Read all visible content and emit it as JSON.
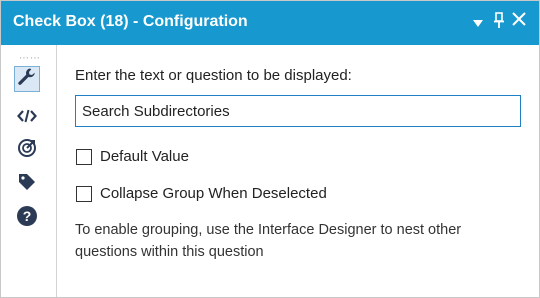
{
  "window": {
    "title": "Check Box (18) - Configuration",
    "controls": {
      "dropdown_icon": "triangle-down",
      "pin_icon": "pin",
      "close_icon": "close"
    }
  },
  "sidebar": {
    "items": [
      {
        "name": "configuration",
        "icon": "wrench",
        "active": true
      },
      {
        "name": "code",
        "icon": "code-brackets",
        "active": false
      },
      {
        "name": "connections",
        "icon": "target",
        "active": false
      },
      {
        "name": "annotation",
        "icon": "tag",
        "active": false
      },
      {
        "name": "help",
        "icon": "question-circle",
        "active": false
      }
    ]
  },
  "form": {
    "prompt_label": "Enter the text or question to be displayed:",
    "question_value": "Search Subdirectories",
    "default_value_label": "Default Value",
    "default_value_checked": false,
    "collapse_group_label": "Collapse Group When Deselected",
    "collapse_group_checked": false,
    "help_text": "To enable grouping, use the Interface Designer to nest other questions within this question"
  },
  "colors": {
    "titlebar_bg": "#1798cf",
    "input_border": "#1e7fc4",
    "icon_dark": "#2b3a55"
  }
}
